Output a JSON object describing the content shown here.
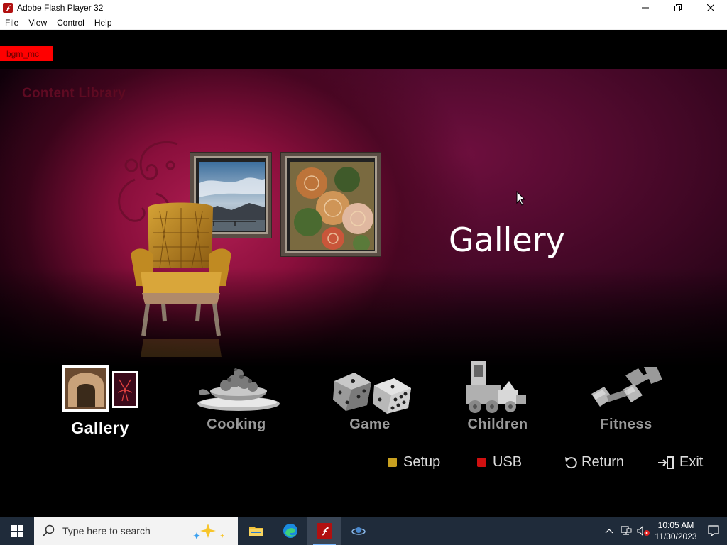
{
  "window": {
    "title": "Adobe Flash Player 32",
    "controls": [
      "minimize",
      "restore",
      "close"
    ]
  },
  "menubar": {
    "items": [
      "File",
      "View",
      "Control",
      "Help"
    ]
  },
  "stage": {
    "debug_tag": "bgm_mc",
    "section_title": "Content Library",
    "selected_title": "Gallery",
    "categories": [
      {
        "label": "Gallery",
        "icon": "gallery-icon",
        "active": true
      },
      {
        "label": "Cooking",
        "icon": "cooking-icon",
        "active": false
      },
      {
        "label": "Game",
        "icon": "dice-icon",
        "active": false
      },
      {
        "label": "Children",
        "icon": "toy-train-icon",
        "active": false
      },
      {
        "label": "Fitness",
        "icon": "dumbbell-icon",
        "active": false
      }
    ],
    "hints": {
      "setup": "Setup",
      "usb": "USB",
      "return": "Return",
      "exit": "Exit"
    },
    "colors": {
      "setup_dot": "#c8a020",
      "usb_dot": "#d01010",
      "debug_tag_bg": "#ff0000"
    }
  },
  "taskbar": {
    "search_placeholder": "Type here to search",
    "apps": [
      "file-explorer-icon",
      "edge-icon",
      "flash-player-icon",
      "app-icon"
    ],
    "clock_time": "10:05 AM",
    "clock_date": "11/30/2023"
  }
}
